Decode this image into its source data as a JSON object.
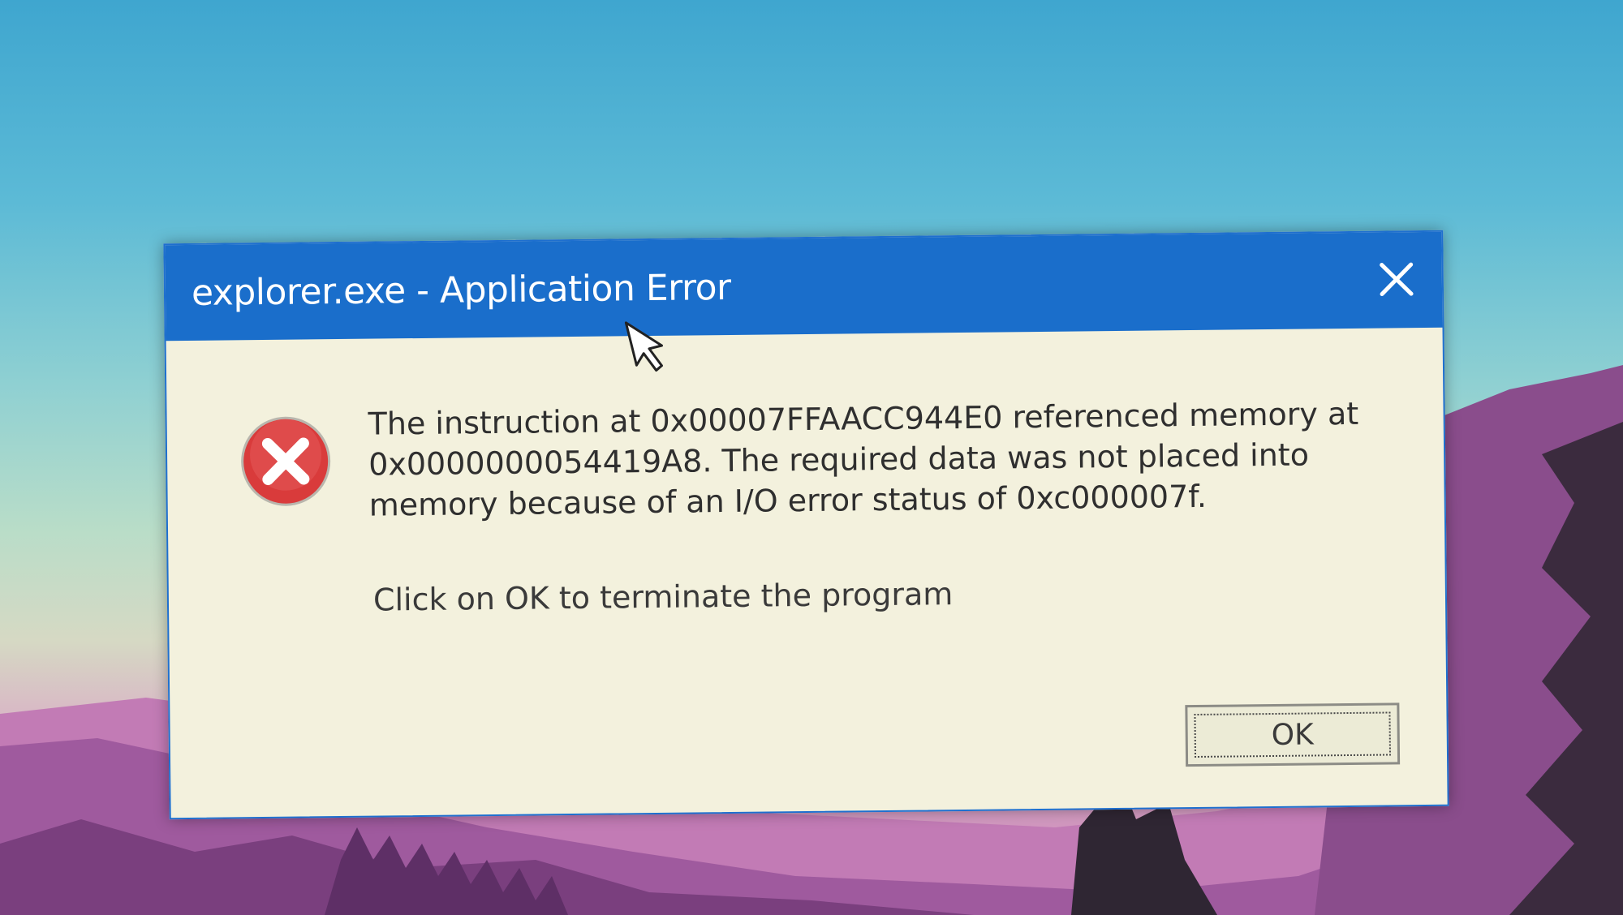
{
  "dialog": {
    "title": "explorer.exe - Application Error",
    "close_icon": "close-icon",
    "status_icon": "error-icon",
    "message_lines": [
      "The instruction at 0x00007FFAACC944E0 referenced memory at",
      "0x0000000054419A8. The required data was not placed into",
      "memory because of an I/O error status of 0xc000007f."
    ],
    "prompt": "Click on OK to terminate the program",
    "ok_label": "OK"
  },
  "colors": {
    "titlebar": "#1a6ecb",
    "dialog_background": "#f3f1dd",
    "error_red": "#d93b3b",
    "text": "#2f2f2f"
  }
}
